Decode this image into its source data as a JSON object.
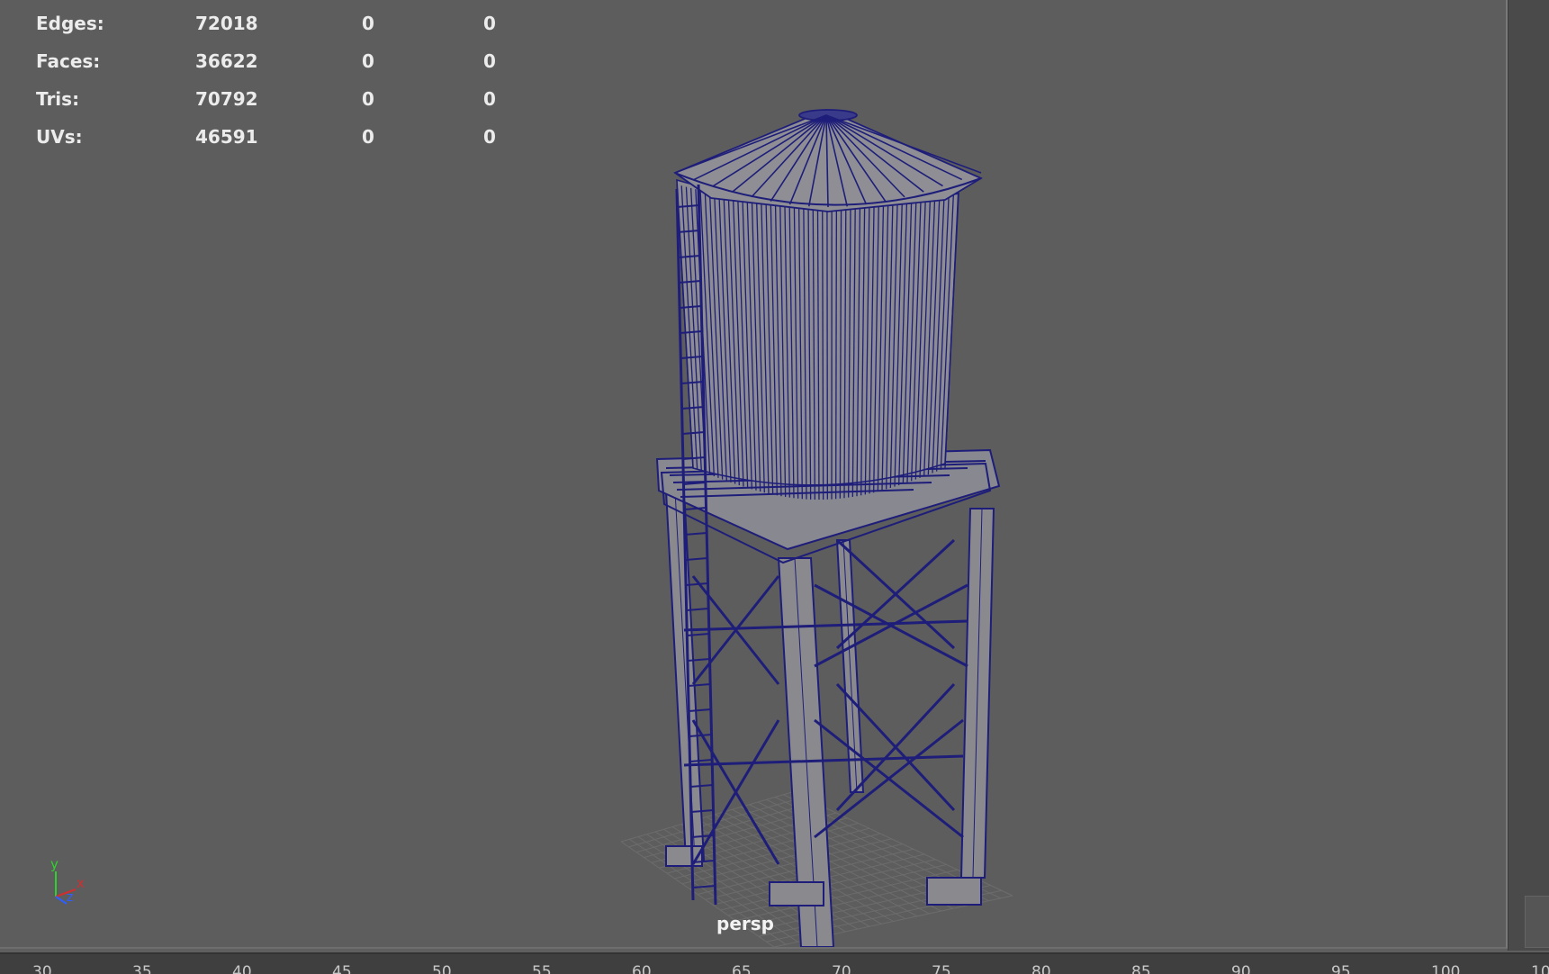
{
  "hud": {
    "rows": [
      {
        "label": "Edges:",
        "count": "72018",
        "selected": "0",
        "component": "0"
      },
      {
        "label": "Faces:",
        "count": "36622",
        "selected": "0",
        "component": "0"
      },
      {
        "label": "Tris:",
        "count": "70792",
        "selected": "0",
        "component": "0"
      },
      {
        "label": "UVs:",
        "count": "46591",
        "selected": "0",
        "component": "0"
      }
    ]
  },
  "viewport": {
    "camera": "persp",
    "background_color": "#5d5d5d",
    "wireframe_color": "#1e1e7a"
  },
  "axis_indicator": {
    "y": "y",
    "x": "x",
    "z": "z"
  },
  "timeline": {
    "ticks": [
      "30",
      "35",
      "40",
      "45",
      "50",
      "55",
      "60",
      "65",
      "70",
      "75",
      "80",
      "85",
      "90",
      "95",
      "100",
      "10"
    ]
  }
}
